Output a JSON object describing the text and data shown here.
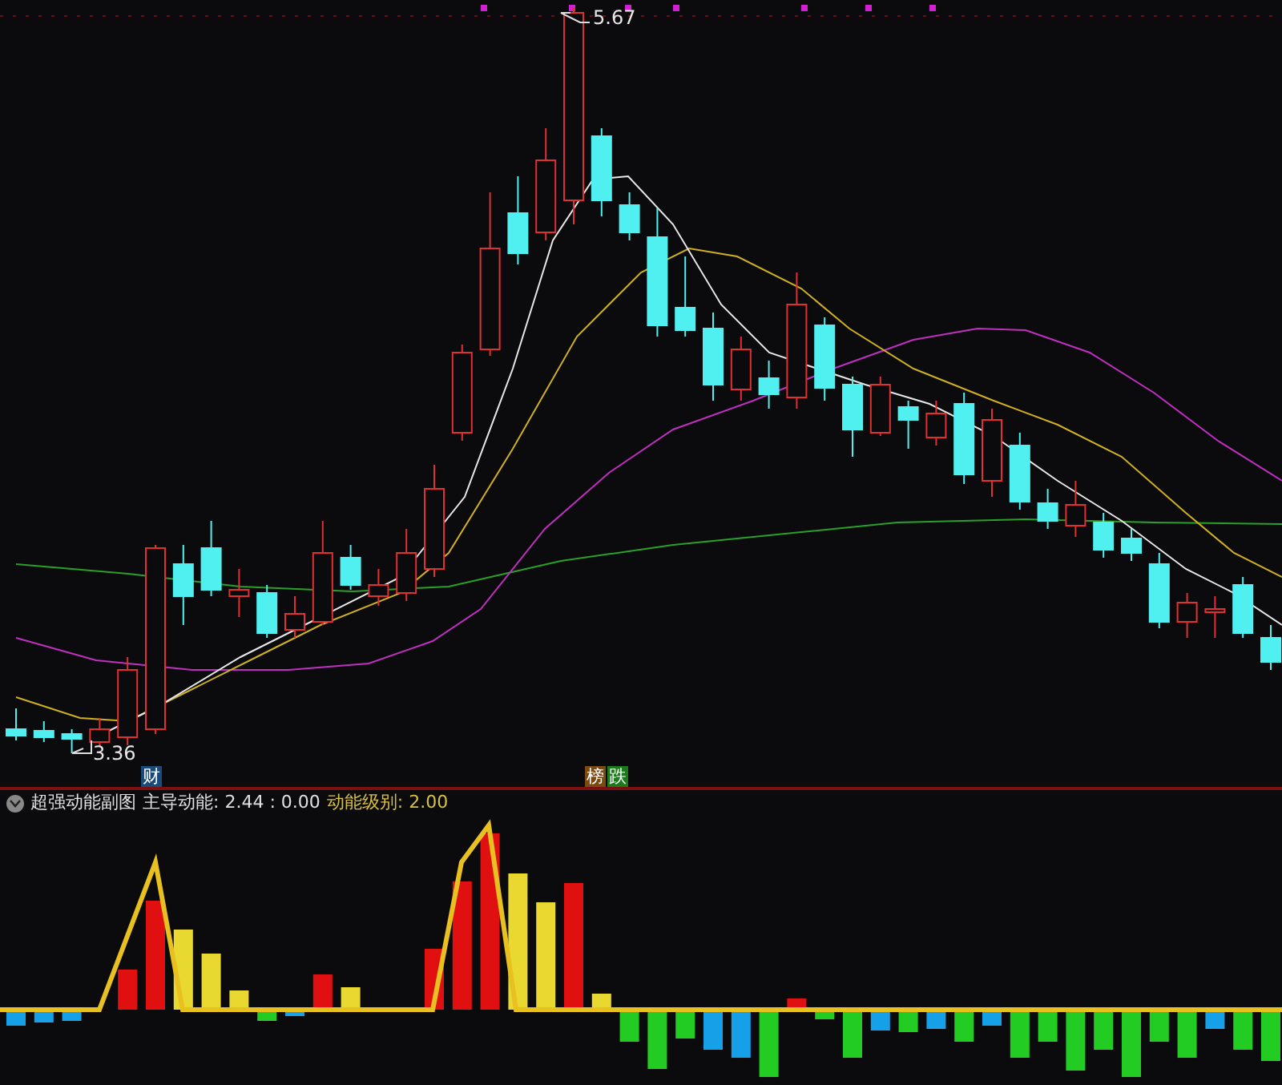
{
  "price_chart": {
    "high_label": "5.67",
    "low_label": "3.36"
  },
  "markers": [
    {
      "text": "财",
      "color": "#1a4a7a"
    },
    {
      "text": "榜",
      "color": "#7a4a10"
    },
    {
      "text": "跌",
      "color": "#1c7a1c"
    }
  ],
  "indicator_header": {
    "title": "超强动能副图",
    "main_reading": "主导动能: 2.44 : 0.00",
    "level_reading": "动能级别: 2.00"
  }
}
